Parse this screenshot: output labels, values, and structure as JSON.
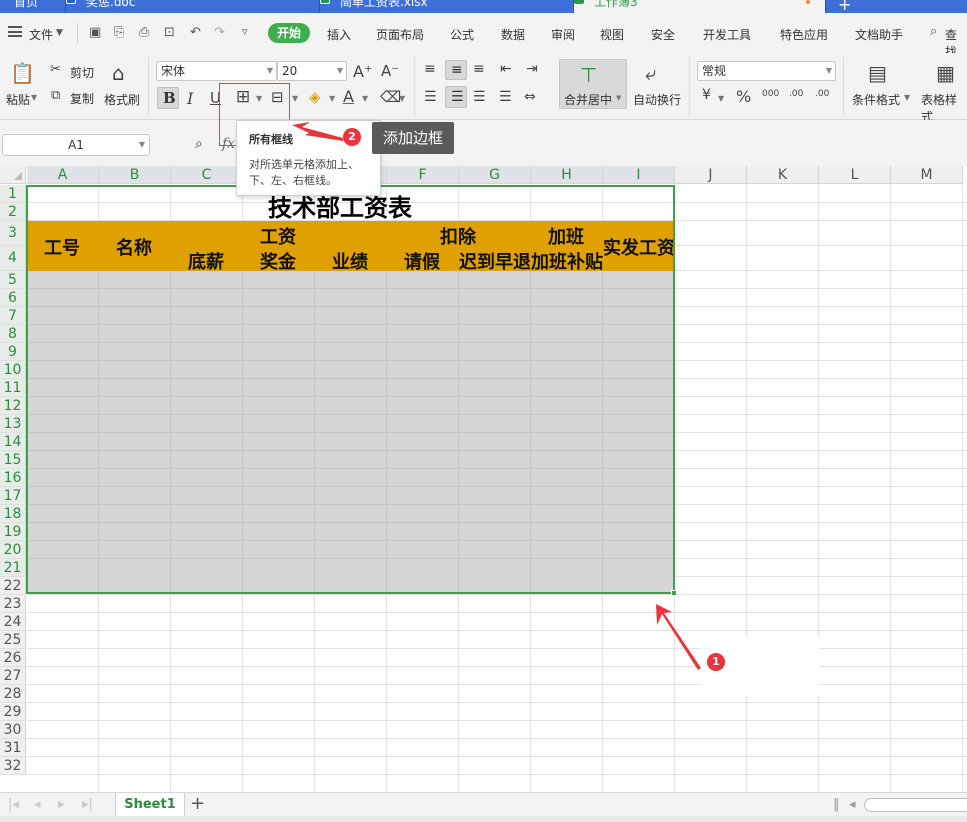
{
  "doc_tabs": [
    {
      "label": "首页",
      "active": false
    },
    {
      "label": "奖惩.doc",
      "active": false
    },
    {
      "label": "简单工资表.xlsx",
      "active": false
    },
    {
      "label": "工作簿3",
      "active": true
    }
  ],
  "menu": {
    "file": "文件",
    "start": "开始",
    "items": [
      "插入",
      "页面布局",
      "公式",
      "数据",
      "审阅",
      "视图",
      "安全",
      "开发工具",
      "特色应用",
      "文档助手"
    ],
    "search": "查找"
  },
  "ribbon": {
    "paste": "粘贴",
    "cut": "剪切",
    "copy": "复制",
    "format_painter": "格式刷",
    "font_name": "宋体",
    "font_size": "20",
    "merge_center": "合并居中",
    "wrap_text": "自动换行",
    "number_format": "常规",
    "conditional_format": "条件格式",
    "table_style": "表格样式",
    "bold": "B",
    "italic": "I",
    "underline": "U",
    "percent": "%",
    "thousands": "000",
    "inc_decimal": ".00",
    "dec_decimal": ".00"
  },
  "formula_bar": {
    "name_box": "A1",
    "fx": "fx"
  },
  "tooltip": {
    "title": "所有框线",
    "desc": "对所选单元格添加上、下、左、右框线。"
  },
  "callout": "添加边框",
  "badges": [
    "1",
    "2"
  ],
  "columns": [
    "A",
    "B",
    "C",
    "D",
    "E",
    "F",
    "G",
    "H",
    "I",
    "J",
    "K",
    "L",
    "M"
  ],
  "rows": [
    "1",
    "2",
    "3",
    "4",
    "5",
    "6",
    "7",
    "8",
    "9",
    "10",
    "11",
    "12",
    "13",
    "14",
    "15",
    "16",
    "17",
    "18",
    "19",
    "20",
    "21",
    "22",
    "23",
    "24",
    "25",
    "26",
    "27",
    "28",
    "29",
    "30",
    "31",
    "32"
  ],
  "sheet": {
    "title": "技术部工资表",
    "h_id": "工号",
    "h_name": "名称",
    "h_base": "底薪",
    "h_salary": "工资",
    "h_bonus": "奖金",
    "h_perf": "业绩",
    "h_deduct": "扣除",
    "h_leave": "请假",
    "h_late": "迟到早退",
    "h_ot": "加班",
    "h_ot_allow": "加班补贴",
    "h_net": "实发工资"
  },
  "sheet_tab": "Sheet1",
  "colors": {
    "accent_green": "#3fa04a",
    "header_band": "#e0a000",
    "tab_bar": "#3d6fd8",
    "annotation_red": "#e8343a"
  }
}
